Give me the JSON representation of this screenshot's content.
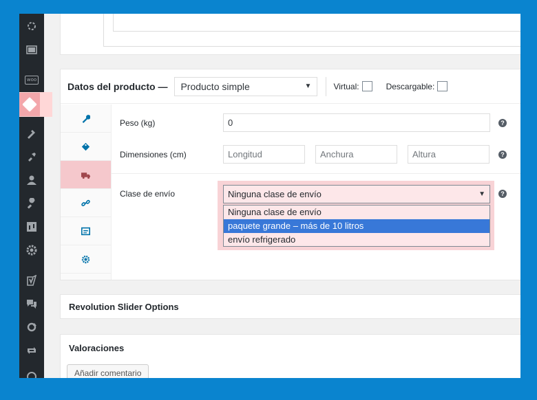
{
  "product_data": {
    "title": "Datos del producto —",
    "type_select": "Producto simple",
    "virtual_label": "Virtual:",
    "downloadable_label": "Descargable:"
  },
  "shipping": {
    "weight_label": "Peso (kg)",
    "weight_value": "0",
    "dimensions_label": "Dimensiones (cm)",
    "length_placeholder": "Longitud",
    "width_placeholder": "Anchura",
    "height_placeholder": "Altura",
    "class_label": "Clase de envío",
    "class_selected": "Ninguna clase de envío",
    "class_options": [
      "Ninguna clase de envío",
      "paquete grande – más de 10 litros",
      "envío refrigerado"
    ],
    "highlighted_option": "paquete grande – más de 10 litros"
  },
  "help_icon": "?",
  "revolution": {
    "title": "Revolution Slider Options"
  },
  "reviews": {
    "title": "Valoraciones",
    "add_comment": "Añadir comentario"
  },
  "sidebar_icons": [
    "gear-cog-icon",
    "media-icon",
    "woocommerce-icon",
    "products-icon",
    "appearance-icon",
    "plugins-icon",
    "users-icon",
    "tools-icon",
    "import-icon",
    "settings-icon",
    "yoast-icon",
    "comments-icon",
    "refresh-icon",
    "retweet-icon"
  ],
  "colors": {
    "highlight": "#f8d3d6",
    "selection": "#3878d8",
    "admin_bar": "#23282d",
    "background": "#0a84cf"
  }
}
